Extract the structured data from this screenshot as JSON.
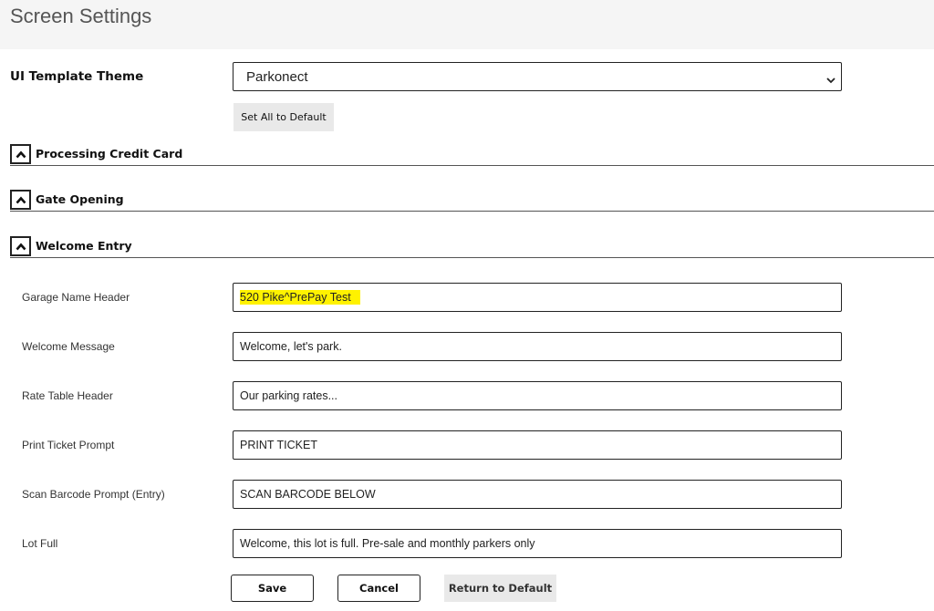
{
  "page": {
    "title": "Screen Settings"
  },
  "theme": {
    "label": "UI Template Theme",
    "selected": "Parkonect",
    "set_all_default_label": "Set All to Default"
  },
  "sections": [
    {
      "label": "Processing Credit Card",
      "icon": "chevron-up-icon"
    },
    {
      "label": "Gate Opening",
      "icon": "chevron-up-icon"
    },
    {
      "label": "Welcome Entry",
      "icon": "chevron-up-icon"
    }
  ],
  "fields": [
    {
      "label": "Garage Name Header",
      "value": "520 Pike^PrePay Test",
      "highlighted": true
    },
    {
      "label": "Welcome Message",
      "value": "Welcome, let's park."
    },
    {
      "label": "Rate Table Header",
      "value": "Our parking rates..."
    },
    {
      "label": "Print Ticket Prompt",
      "value": "PRINT TICKET"
    },
    {
      "label": "Scan Barcode Prompt (Entry)",
      "value": "SCAN BARCODE BELOW"
    },
    {
      "label": "Lot Full",
      "value": "Welcome, this lot is full. Pre-sale and monthly parkers only"
    }
  ],
  "actions": {
    "save": "Save",
    "cancel": "Cancel",
    "return_default": "Return to Default"
  },
  "colors": {
    "header_bg": "#f5f5f5",
    "highlight": "#fff200",
    "button_gray": "#e9e9e9"
  }
}
